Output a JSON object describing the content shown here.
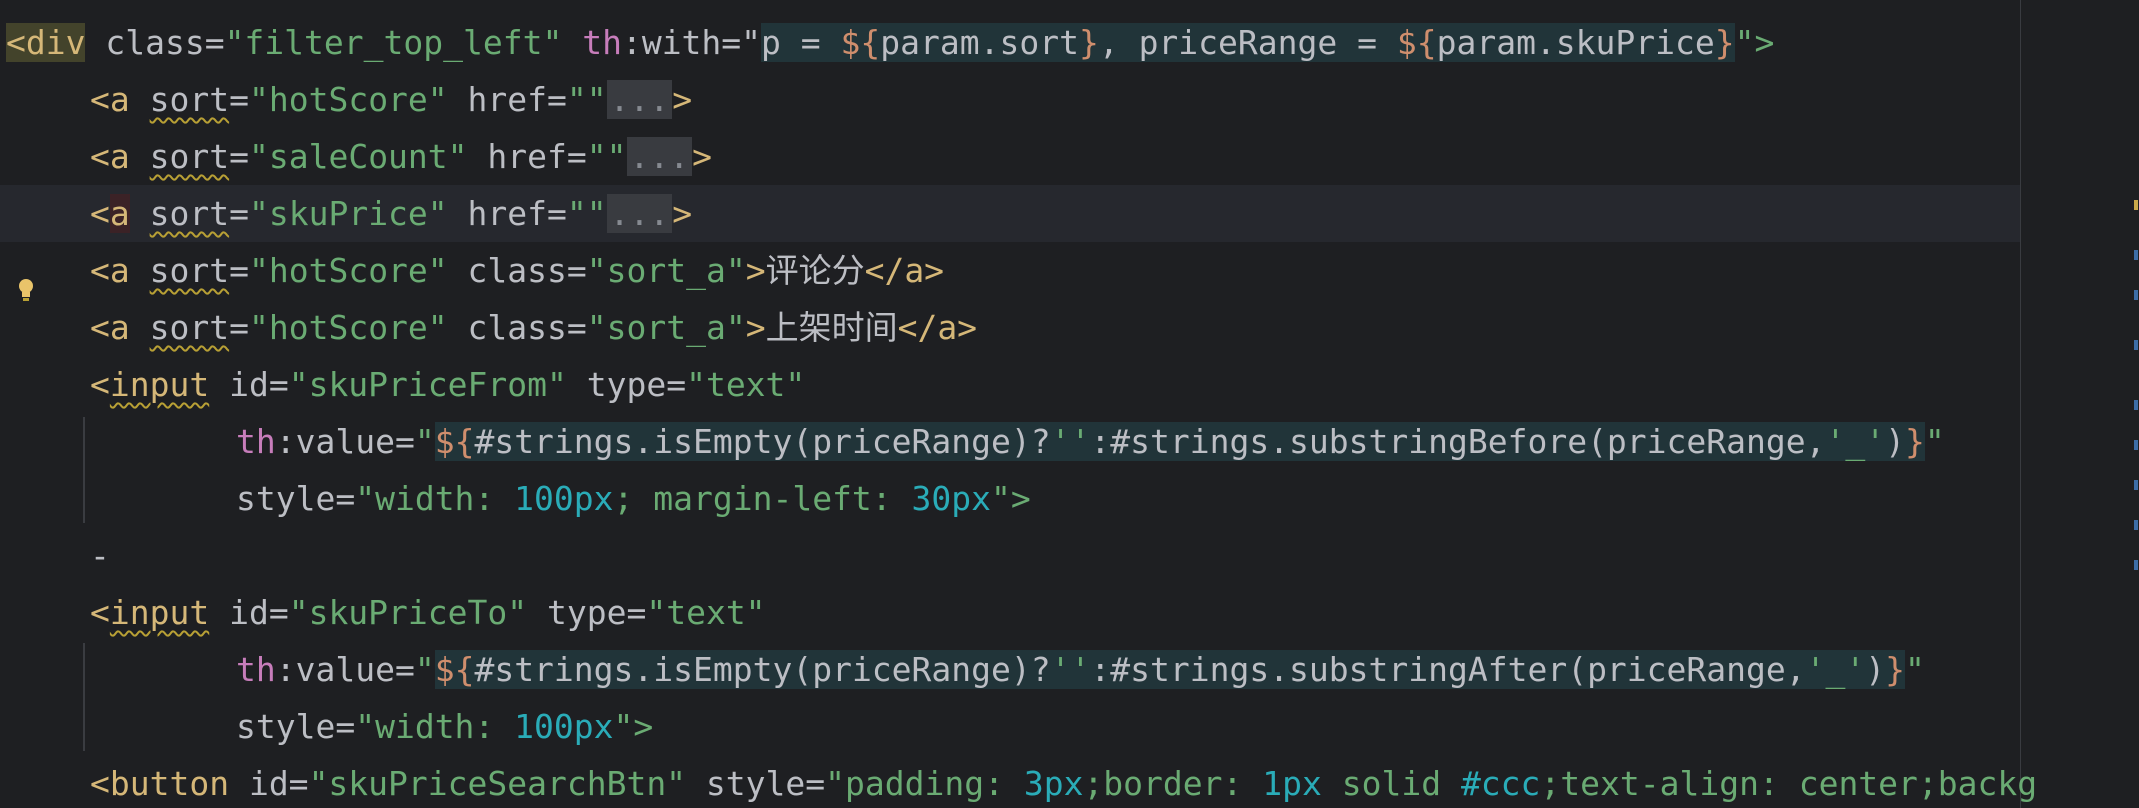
{
  "editor": {
    "lines": [
      {
        "id": "l1",
        "parts": [
          "<div",
          " class=",
          "\"filter_top_left\"",
          " ",
          "th",
          ":with=\"",
          "p = ",
          "${",
          "param.sort",
          "}",
          ", priceRange = ",
          "${",
          "param.skuPrice",
          "}",
          "\">"
        ]
      },
      {
        "id": "l2",
        "parts": [
          "<a",
          " ",
          "sort",
          "=",
          "\"hotScore\"",
          " href=",
          "\"\"",
          "...",
          ">"
        ]
      },
      {
        "id": "l3",
        "parts": [
          "<a",
          " ",
          "sort",
          "=",
          "\"saleCount\"",
          " href=",
          "\"\"",
          "...",
          ">"
        ]
      },
      {
        "id": "l4",
        "parts": [
          "<",
          "a",
          " ",
          "sort",
          "=",
          "\"skuPrice\"",
          " href=",
          "\"\"",
          "...",
          ">"
        ]
      },
      {
        "id": "l5",
        "parts": [
          "<a",
          " ",
          "sort",
          "=",
          "\"hotScore\"",
          " class=",
          "\"sort_a\"",
          ">",
          "评论分",
          "</a>"
        ]
      },
      {
        "id": "l6",
        "parts": [
          "<a",
          " ",
          "sort",
          "=",
          "\"hotScore\"",
          " class=",
          "\"sort_a\"",
          ">",
          "上架时间",
          "</a>"
        ]
      },
      {
        "id": "l7",
        "parts": [
          "<",
          "input",
          " id=",
          "\"skuPriceFrom\"",
          " type=",
          "\"text\""
        ]
      },
      {
        "id": "l8",
        "parts": [
          "th",
          ":value=",
          "\"",
          "${",
          "#strings.isEmpty(priceRange)?",
          "''",
          ":#strings.substringBefore(priceRange,",
          "'_'",
          ")",
          "}",
          "\""
        ]
      },
      {
        "id": "l9",
        "parts": [
          "style=",
          "\"width: ",
          "100px",
          "; margin-left: ",
          "30px",
          "\">"
        ]
      },
      {
        "id": "l10",
        "parts": [
          "-"
        ]
      },
      {
        "id": "l11",
        "parts": [
          "<",
          "input",
          " id=",
          "\"skuPriceTo\"",
          " type=",
          "\"text\""
        ]
      },
      {
        "id": "l12",
        "parts": [
          "th",
          ":value=",
          "\"",
          "${",
          "#strings.isEmpty(priceRange)?",
          "''",
          ":#strings.substringAfter(priceRange,",
          "'_'",
          ")",
          "}",
          "\""
        ]
      },
      {
        "id": "l13",
        "parts": [
          "style=",
          "\"width: ",
          "100px",
          "\">"
        ]
      },
      {
        "id": "l14",
        "parts": [
          "<button",
          " id=",
          "\"skuPriceSearchBtn\"",
          " style=",
          "\"padding: ",
          "3px",
          ";border: ",
          "1px",
          " solid ",
          "#ccc",
          ";text-align: ",
          "center",
          ";backg"
        ]
      }
    ],
    "intention_icon": "lightbulb-icon",
    "colors": {
      "background": "#1e1f22",
      "tag": "#d5b778",
      "string": "#6aab73",
      "namespace": "#c77dbb",
      "number": "#2aacb8",
      "text": "#bcbec4",
      "warning_underline": "#b8a035"
    }
  }
}
